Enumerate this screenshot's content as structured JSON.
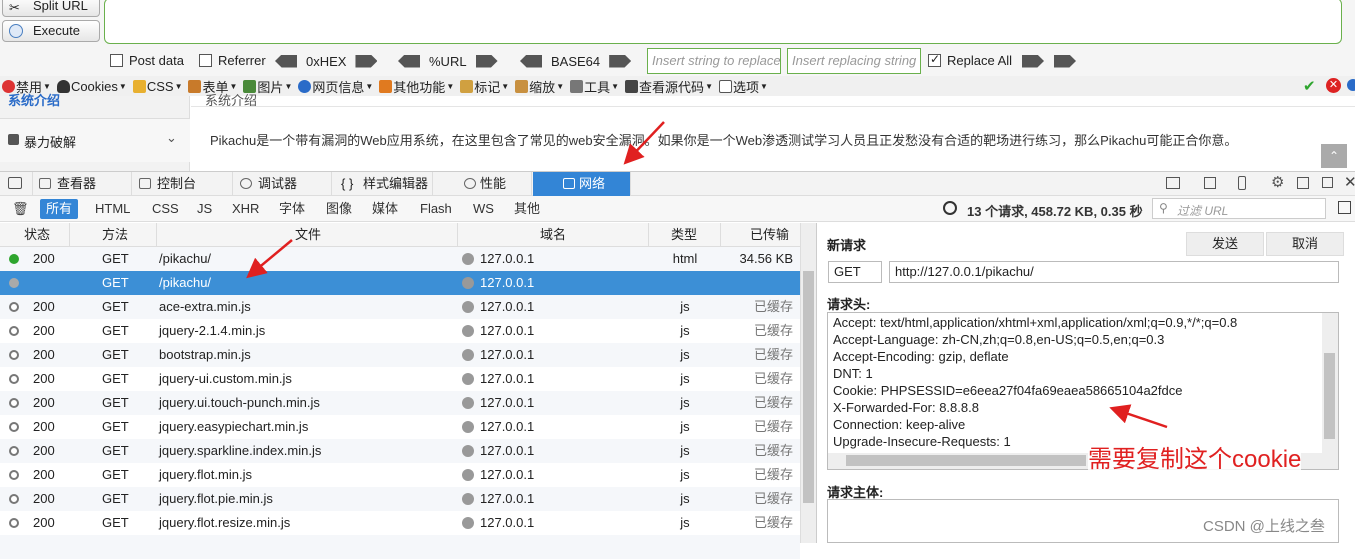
{
  "hackbar": {
    "split_url": "Split URL",
    "execute": "Execute",
    "post_data": "Post data",
    "referrer": "Referrer",
    "hex": "0xHEX",
    "url_enc": "%URL",
    "base64": "BASE64",
    "find_placeholder": "Insert string to replace",
    "replace_placeholder": "Insert replacing string",
    "replace_all": "Replace All"
  },
  "toolbar": {
    "items": [
      "禁用",
      "Cookies",
      "CSS",
      "表单",
      "图片",
      "网页信息",
      "其他功能",
      "标记",
      "缩放",
      "工具",
      "查看源代码",
      "选项"
    ]
  },
  "page": {
    "sidebar_top": "系统介绍",
    "sidebar_item": "暴力破解",
    "section_title": "系统介绍",
    "intro": "Pikachu是一个带有漏洞的Web应用系统，在这里包含了常见的web安全漏洞。如果你是一个Web渗透测试学习人员且正发愁没有合适的靶场进行练习，那么Pikachu可能正合你意。"
  },
  "devtools": {
    "tabs": [
      "查看器",
      "控制台",
      "调试器",
      "样式编辑器",
      "性能",
      "网络"
    ],
    "filters": [
      "所有",
      "HTML",
      "CSS",
      "JS",
      "XHR",
      "字体",
      "图像",
      "媒体",
      "Flash",
      "WS",
      "其他"
    ],
    "summary": "13 个请求, 458.72 KB, 0.35 秒",
    "filter_placeholder": "过滤 URL",
    "columns": {
      "status": "状态",
      "method": "方法",
      "file": "文件",
      "domain": "域名",
      "type": "类型",
      "transferred": "已传输"
    },
    "requests": [
      {
        "status": "200",
        "method": "GET",
        "file": "/pikachu/",
        "domain": "127.0.0.1",
        "type": "html",
        "size": "34.56 KB"
      },
      {
        "status": "",
        "method": "GET",
        "file": "/pikachu/",
        "domain": "127.0.0.1",
        "type": "",
        "size": ""
      },
      {
        "status": "200",
        "method": "GET",
        "file": "ace-extra.min.js",
        "domain": "127.0.0.1",
        "type": "js",
        "size": "已缓存"
      },
      {
        "status": "200",
        "method": "GET",
        "file": "jquery-2.1.4.min.js",
        "domain": "127.0.0.1",
        "type": "js",
        "size": "已缓存"
      },
      {
        "status": "200",
        "method": "GET",
        "file": "bootstrap.min.js",
        "domain": "127.0.0.1",
        "type": "js",
        "size": "已缓存"
      },
      {
        "status": "200",
        "method": "GET",
        "file": "jquery-ui.custom.min.js",
        "domain": "127.0.0.1",
        "type": "js",
        "size": "已缓存"
      },
      {
        "status": "200",
        "method": "GET",
        "file": "jquery.ui.touch-punch.min.js",
        "domain": "127.0.0.1",
        "type": "js",
        "size": "已缓存"
      },
      {
        "status": "200",
        "method": "GET",
        "file": "jquery.easypiechart.min.js",
        "domain": "127.0.0.1",
        "type": "js",
        "size": "已缓存"
      },
      {
        "status": "200",
        "method": "GET",
        "file": "jquery.sparkline.index.min.js",
        "domain": "127.0.0.1",
        "type": "js",
        "size": "已缓存"
      },
      {
        "status": "200",
        "method": "GET",
        "file": "jquery.flot.min.js",
        "domain": "127.0.0.1",
        "type": "js",
        "size": "已缓存"
      },
      {
        "status": "200",
        "method": "GET",
        "file": "jquery.flot.pie.min.js",
        "domain": "127.0.0.1",
        "type": "js",
        "size": "已缓存"
      },
      {
        "status": "200",
        "method": "GET",
        "file": "jquery.flot.resize.min.js",
        "domain": "127.0.0.1",
        "type": "js",
        "size": "已缓存"
      }
    ],
    "new_request": {
      "title": "新请求",
      "send": "发送",
      "cancel": "取消",
      "method": "GET",
      "url": "http://127.0.0.1/pikachu/",
      "headers_label": "请求头:",
      "headers": [
        "Accept: text/html,application/xhtml+xml,application/xml;q=0.9,*/*;q=0.8",
        "Accept-Language: zh-CN,zh;q=0.8,en-US;q=0.5,en;q=0.3",
        "Accept-Encoding: gzip, deflate",
        "DNT: 1",
        "Cookie: PHPSESSID=e6eea27f04fa69eaea58665104a2fdce",
        "X-Forwarded-For: 8.8.8.8",
        "Connection: keep-alive",
        "Upgrade-Insecure-Requests: 1"
      ],
      "body_label": "请求主体:"
    }
  },
  "annotation": "需要复制这个cookie",
  "watermark": "CSDN @上线之叁",
  "colors": {
    "accent": "#3385d6",
    "annotation": "#e02020",
    "hackbar_border": "#6ab04c"
  }
}
